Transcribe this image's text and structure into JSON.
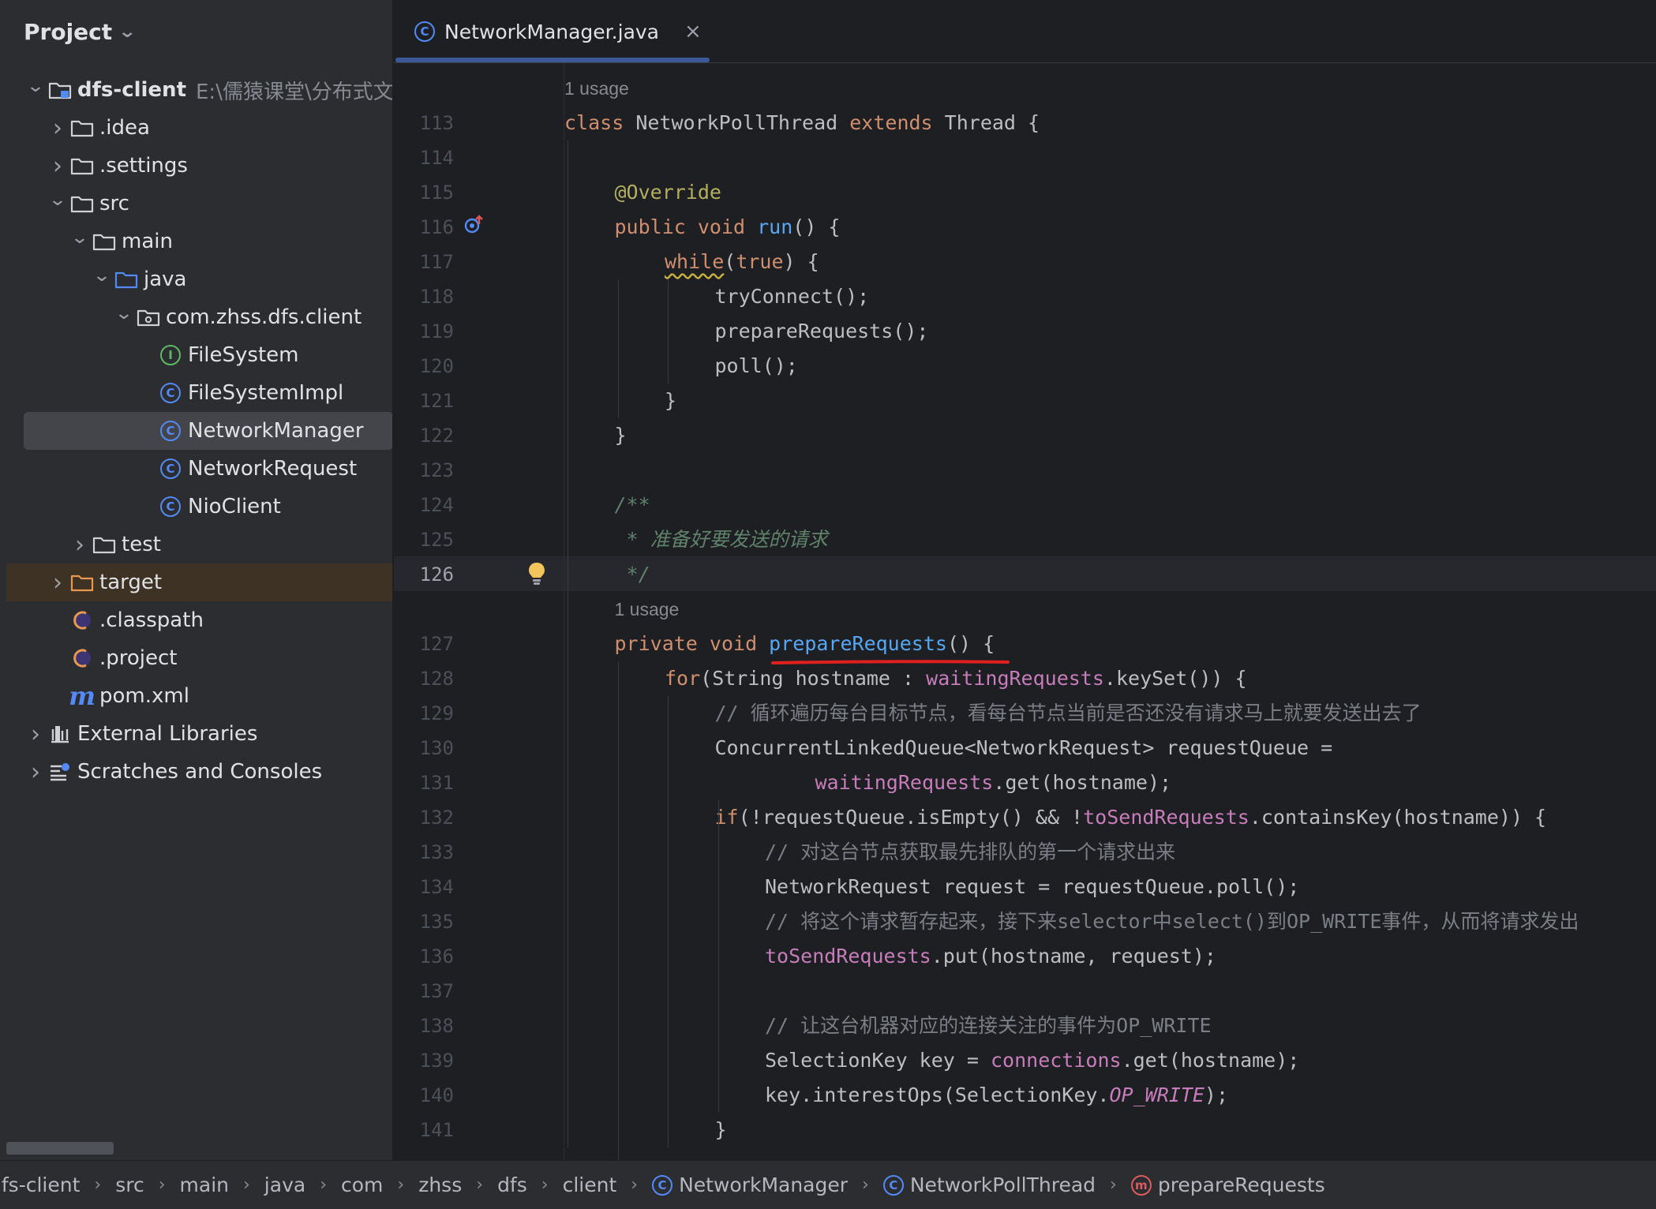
{
  "sidebar": {
    "title": "Project",
    "tree": [
      {
        "label": "dfs-client",
        "path": "E:\\儒猿课堂\\分布式文",
        "arrow": "open",
        "icon": "module-folder-icon",
        "indent": 0,
        "bold": true
      },
      {
        "label": ".idea",
        "arrow": "closed",
        "icon": "folder-icon",
        "indent": 1
      },
      {
        "label": ".settings",
        "arrow": "closed",
        "icon": "folder-icon",
        "indent": 1
      },
      {
        "label": "src",
        "arrow": "open",
        "icon": "folder-icon",
        "indent": 1
      },
      {
        "label": "main",
        "arrow": "open",
        "icon": "folder-icon",
        "indent": 2
      },
      {
        "label": "java",
        "arrow": "open",
        "icon": "source-folder-icon",
        "indent": 3
      },
      {
        "label": "com.zhss.dfs.client",
        "arrow": "open",
        "icon": "package-icon",
        "indent": 4
      },
      {
        "label": "FileSystem",
        "arrow": "",
        "icon": "interface-icon",
        "indent": 5
      },
      {
        "label": "FileSystemImpl",
        "arrow": "",
        "icon": "class-icon",
        "indent": 5
      },
      {
        "label": "NetworkManager",
        "arrow": "",
        "icon": "class-icon",
        "indent": 5,
        "selected": true
      },
      {
        "label": "NetworkRequest",
        "arrow": "",
        "icon": "class-icon",
        "indent": 5
      },
      {
        "label": "NioClient",
        "arrow": "",
        "icon": "class-icon",
        "indent": 5
      },
      {
        "label": "test",
        "arrow": "closed",
        "icon": "folder-icon",
        "indent": 2
      },
      {
        "label": "target",
        "arrow": "closed",
        "icon": "excluded-folder-icon",
        "indent": 1,
        "highlight": true
      },
      {
        "label": ".classpath",
        "arrow": "",
        "icon": "eclipse-file-icon",
        "indent": 1
      },
      {
        "label": ".project",
        "arrow": "",
        "icon": "eclipse-file-icon",
        "indent": 1
      },
      {
        "label": "pom.xml",
        "arrow": "",
        "icon": "maven-icon",
        "indent": 1
      },
      {
        "label": "External Libraries",
        "arrow": "closed",
        "icon": "library-icon",
        "indent": 0
      },
      {
        "label": "Scratches and Consoles",
        "arrow": "closed",
        "icon": "scratches-icon",
        "indent": 0
      }
    ]
  },
  "editor": {
    "tab": {
      "label": "NetworkManager.java",
      "icon": "class-icon",
      "close": "×"
    },
    "current_line": 126,
    "lines": [
      {
        "usage": "1 usage",
        "indent": 0
      },
      {
        "n": "113",
        "indent": 0,
        "tokens": [
          [
            "kw",
            "class "
          ],
          [
            "",
            "NetworkPollThread "
          ],
          [
            "kw",
            "extends "
          ],
          [
            "",
            "Thread {"
          ]
        ]
      },
      {
        "n": "114",
        "indent": 0,
        "tokens": []
      },
      {
        "n": "115",
        "indent": 1,
        "tokens": [
          [
            "an",
            "@Override"
          ]
        ]
      },
      {
        "n": "116",
        "indent": 1,
        "tokens": [
          [
            "kw",
            "public void "
          ],
          [
            "fn",
            "run"
          ],
          [
            "",
            "() {"
          ]
        ]
      },
      {
        "n": "117",
        "indent": 2,
        "tokens": [
          [
            "kw ul-warn",
            "while"
          ],
          [
            "",
            "("
          ],
          [
            "kw",
            "true"
          ],
          [
            "",
            ") {"
          ]
        ]
      },
      {
        "n": "118",
        "indent": 3,
        "tokens": [
          [
            "",
            "tryConnect();"
          ]
        ]
      },
      {
        "n": "119",
        "indent": 3,
        "tokens": [
          [
            "",
            "prepareRequests();"
          ]
        ]
      },
      {
        "n": "120",
        "indent": 3,
        "tokens": [
          [
            "",
            "poll();"
          ]
        ]
      },
      {
        "n": "121",
        "indent": 2,
        "tokens": [
          [
            "",
            "}"
          ]
        ]
      },
      {
        "n": "122",
        "indent": 1,
        "tokens": [
          [
            "",
            "}"
          ]
        ]
      },
      {
        "n": "123",
        "indent": 0,
        "tokens": []
      },
      {
        "n": "124",
        "indent": 1,
        "tokens": [
          [
            "doc",
            "/**"
          ]
        ]
      },
      {
        "n": "125",
        "indent": 1,
        "tokens": [
          [
            "doc",
            " * 准备好要发送的请求"
          ]
        ]
      },
      {
        "n": "126",
        "indent": 1,
        "tokens": [
          [
            "doc",
            " */"
          ]
        ]
      },
      {
        "usage": "1 usage",
        "indent": 1
      },
      {
        "n": "127",
        "indent": 1,
        "tokens": [
          [
            "kw",
            "private void "
          ],
          [
            "fn",
            "prepareRequests"
          ],
          [
            "",
            "() {"
          ]
        ]
      },
      {
        "n": "128",
        "indent": 2,
        "tokens": [
          [
            "kw",
            "for"
          ],
          [
            "",
            "(String hostname : "
          ],
          [
            "fld",
            "waitingRequests"
          ],
          [
            "",
            ".keySet()) {"
          ]
        ]
      },
      {
        "n": "129",
        "indent": 3,
        "tokens": [
          [
            "cm",
            "// 循环遍历每台目标节点，看每台节点当前是否还没有请求马上就要发送出去了"
          ]
        ]
      },
      {
        "n": "130",
        "indent": 3,
        "tokens": [
          [
            "",
            "ConcurrentLinkedQueue<NetworkRequest> requestQueue ="
          ]
        ]
      },
      {
        "n": "131",
        "indent": 5,
        "tokens": [
          [
            "fld",
            "waitingRequests"
          ],
          [
            "",
            ".get(hostname);"
          ]
        ]
      },
      {
        "n": "132",
        "indent": 3,
        "tokens": [
          [
            "kw",
            "if"
          ],
          [
            "",
            "(!requestQueue.isEmpty() && !"
          ],
          [
            "fld",
            "toSendRequests"
          ],
          [
            "",
            ".containsKey(hostname)) {"
          ]
        ]
      },
      {
        "n": "133",
        "indent": 4,
        "tokens": [
          [
            "cm",
            "// 对这台节点获取最先排队的第一个请求出来"
          ]
        ]
      },
      {
        "n": "134",
        "indent": 4,
        "tokens": [
          [
            "",
            "NetworkRequest request = requestQueue.poll();"
          ]
        ]
      },
      {
        "n": "135",
        "indent": 4,
        "tokens": [
          [
            "cm",
            "// 将这个请求暂存起来，接下来selector中select()到OP_WRITE事件，从而将请求发出"
          ]
        ]
      },
      {
        "n": "136",
        "indent": 4,
        "tokens": [
          [
            "fld",
            "toSendRequests"
          ],
          [
            "",
            ".put(hostname, request);"
          ]
        ]
      },
      {
        "n": "137",
        "indent": 0,
        "tokens": []
      },
      {
        "n": "138",
        "indent": 4,
        "tokens": [
          [
            "cm",
            "// 让这台机器对应的连接关注的事件为OP_WRITE"
          ]
        ]
      },
      {
        "n": "139",
        "indent": 4,
        "tokens": [
          [
            "",
            "SelectionKey key = "
          ],
          [
            "fld",
            "connections"
          ],
          [
            "",
            ".get(hostname);"
          ]
        ]
      },
      {
        "n": "140",
        "indent": 4,
        "tokens": [
          [
            "",
            "key.interestOps(SelectionKey."
          ],
          [
            "fld-it",
            "OP_WRITE"
          ],
          [
            "",
            ");"
          ]
        ]
      },
      {
        "n": "141",
        "indent": 3,
        "tokens": [
          [
            "",
            "}"
          ]
        ]
      }
    ]
  },
  "breadcrumb": [
    {
      "label": "dfs-client",
      "icon": ""
    },
    {
      "label": "src",
      "icon": ""
    },
    {
      "label": "main",
      "icon": ""
    },
    {
      "label": "java",
      "icon": ""
    },
    {
      "label": "com",
      "icon": ""
    },
    {
      "label": "zhss",
      "icon": ""
    },
    {
      "label": "dfs",
      "icon": ""
    },
    {
      "label": "client",
      "icon": ""
    },
    {
      "label": "NetworkManager",
      "icon": "class-icon"
    },
    {
      "label": "NetworkPollThread",
      "icon": "class-icon"
    },
    {
      "label": "prepareRequests",
      "icon": "method-icon"
    }
  ],
  "colors": {
    "class_icon": "#548af7",
    "interface_icon": "#5fb865",
    "annotation_red_underline": "#e0201e"
  }
}
